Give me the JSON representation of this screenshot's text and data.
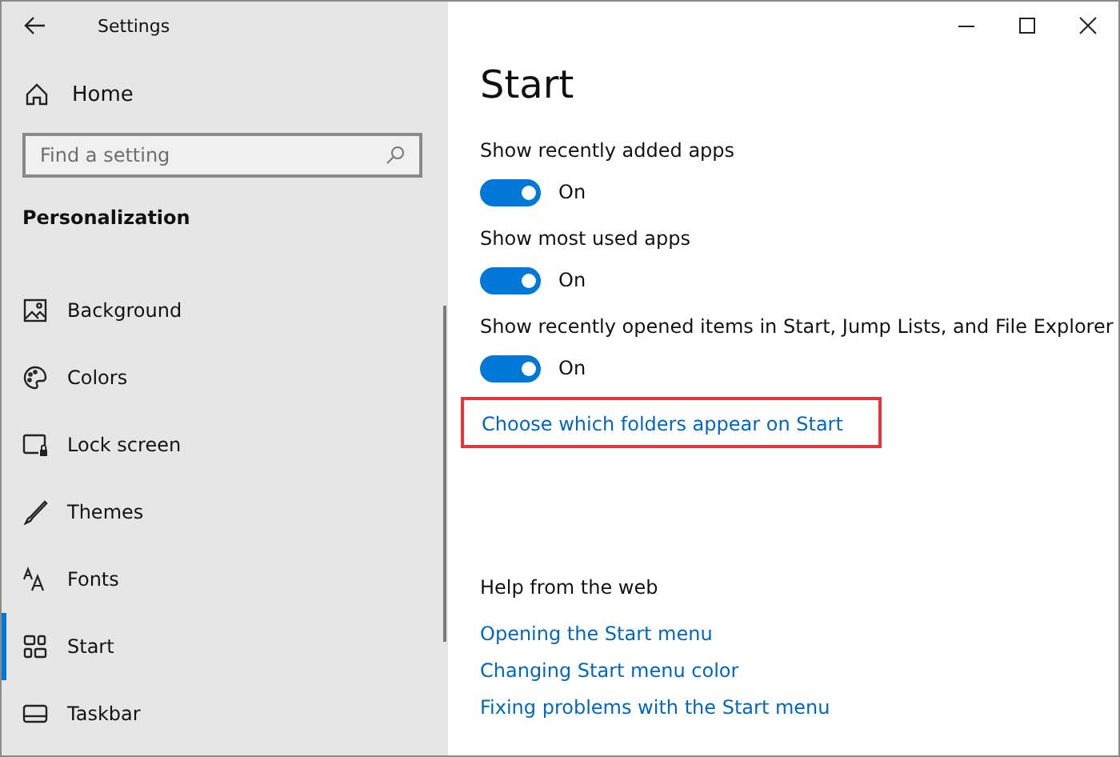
{
  "window": {
    "title": "Settings",
    "controls": [
      {
        "kind": "minimize"
      },
      {
        "kind": "maximize"
      },
      {
        "kind": "close"
      }
    ]
  },
  "sidebar": {
    "home": "Home",
    "search": {
      "placeholder": "Find a setting"
    },
    "section": "Personalization",
    "items": [
      {
        "label": "Background",
        "kind": "image",
        "selected": false
      },
      {
        "label": "Colors",
        "kind": "palette",
        "selected": false
      },
      {
        "label": "Lock screen",
        "kind": "lock",
        "selected": false
      },
      {
        "label": "Themes",
        "kind": "brush",
        "selected": false
      },
      {
        "label": "Fonts",
        "kind": "fonts",
        "selected": false
      },
      {
        "label": "Start",
        "kind": "start",
        "selected": true
      },
      {
        "label": "Taskbar",
        "kind": "taskbar",
        "selected": false
      }
    ]
  },
  "page": {
    "title": "Start",
    "settings": [
      {
        "label": "Show recently added apps",
        "on": true,
        "state": "On"
      },
      {
        "label": "Show most used apps",
        "on": true,
        "state": "On"
      },
      {
        "label": "Show recently opened items in Start, Jump Lists, and File Explorer",
        "on": true,
        "state": "On"
      }
    ],
    "link": {
      "text": "Choose which folders appear on Start",
      "highlighted": true
    },
    "help": {
      "title": "Help from the web",
      "links": [
        "Opening the Start menu",
        "Changing Start menu color",
        "Fixing problems with the Start menu"
      ]
    }
  }
}
